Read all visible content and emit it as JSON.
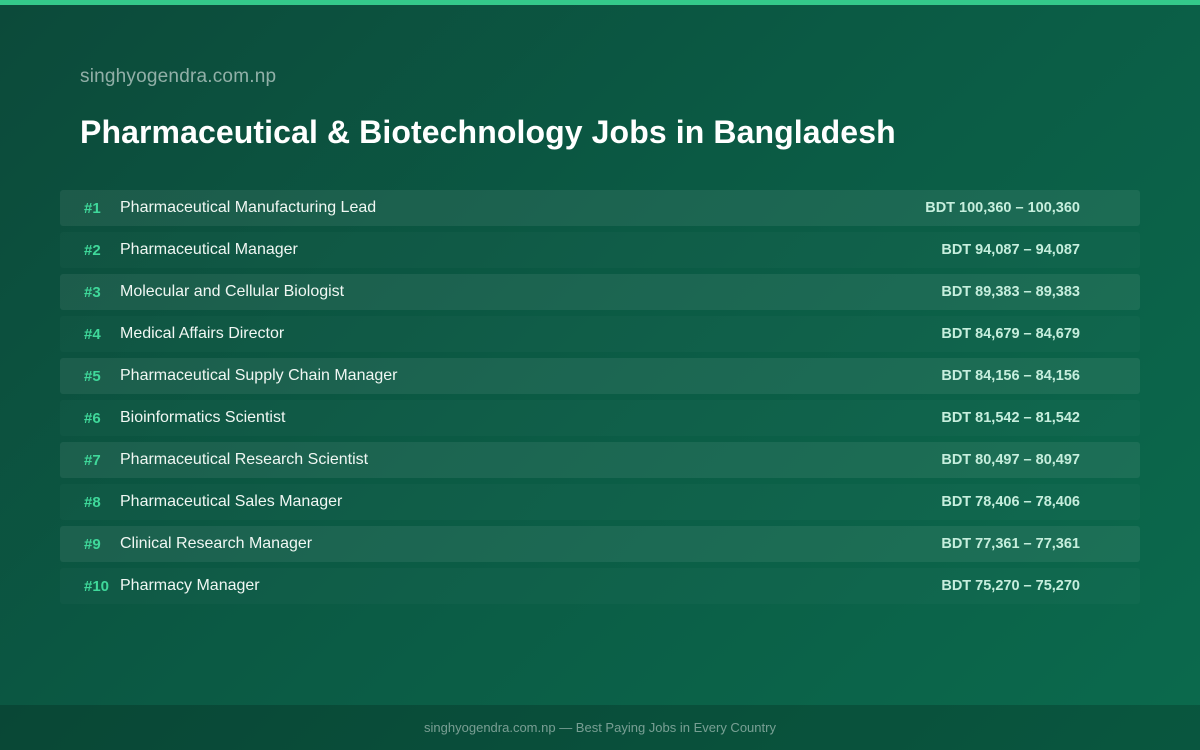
{
  "header": {
    "site": "singhyogendra.com.np",
    "title": "Pharmaceutical & Biotechnology Jobs in Bangladesh"
  },
  "colors": {
    "accent": "#34c98a",
    "rank": "#3fd89a",
    "background_start": "#0c4a3a",
    "background_end": "#0b6a4d"
  },
  "jobs": [
    {
      "rank": "#1",
      "title": "Pharmaceutical Manufacturing Lead",
      "salary": "BDT 100,360 – 100,360"
    },
    {
      "rank": "#2",
      "title": "Pharmaceutical Manager",
      "salary": "BDT 94,087 – 94,087"
    },
    {
      "rank": "#3",
      "title": "Molecular and Cellular Biologist",
      "salary": "BDT 89,383 – 89,383"
    },
    {
      "rank": "#4",
      "title": "Medical Affairs Director",
      "salary": "BDT 84,679 – 84,679"
    },
    {
      "rank": "#5",
      "title": "Pharmaceutical Supply Chain Manager",
      "salary": "BDT 84,156 – 84,156"
    },
    {
      "rank": "#6",
      "title": "Bioinformatics Scientist",
      "salary": "BDT 81,542 – 81,542"
    },
    {
      "rank": "#7",
      "title": "Pharmaceutical Research Scientist",
      "salary": "BDT 80,497 – 80,497"
    },
    {
      "rank": "#8",
      "title": "Pharmaceutical Sales Manager",
      "salary": "BDT 78,406 – 78,406"
    },
    {
      "rank": "#9",
      "title": "Clinical Research Manager",
      "salary": "BDT 77,361 – 77,361"
    },
    {
      "rank": "#10",
      "title": "Pharmacy Manager",
      "salary": "BDT 75,270 – 75,270"
    }
  ],
  "footer": {
    "text": "singhyogendra.com.np — Best Paying Jobs in Every Country"
  }
}
